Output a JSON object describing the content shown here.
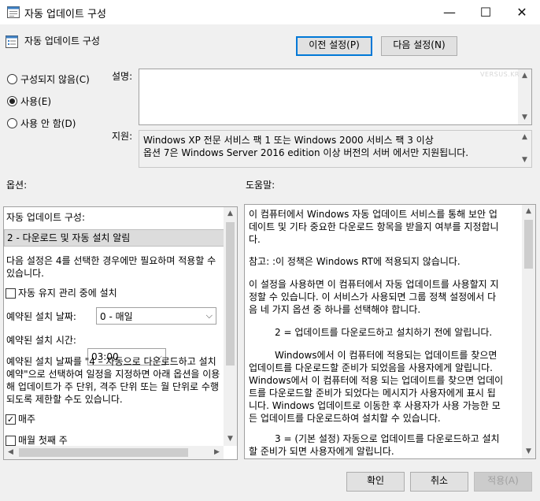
{
  "window": {
    "title": "자동 업데이트 구성",
    "minimize": "—",
    "maximize": "☐",
    "close": "✕"
  },
  "header": {
    "policy_title": "자동 업데이트 구성",
    "prev_button": "이전 설정(P)",
    "next_button": "다음 설정(N)"
  },
  "state": {
    "not_configured": "구성되지 않음(C)",
    "enabled": "사용(E)",
    "disabled": "사용 안 함(D)",
    "selected": "enabled"
  },
  "comment": {
    "label": "설명:",
    "value": "",
    "watermark": "VERSUS.KR"
  },
  "supported": {
    "label": "지원:",
    "line1": "Windows XP 전문 서비스 팩 1 또는 Windows 2000 서비스 팩 3 이상",
    "line2": "옵션 7은 Windows Server 2016 edition 이상 버전의 서버 에서만 지원됩니다."
  },
  "options": {
    "label": "옵션:",
    "configure_label": "자동 업데이트 구성:",
    "configure_value": "2 - 다운로드 및 자동 설치 알림",
    "note_line1": "다음 설정은 4를 선택한 경우에만 필요하며 적용할 수",
    "note_line2": "있습니다.",
    "maintenance_label": "자동 유지 관리 중에 설치",
    "maintenance_checked": false,
    "day_label": "예약된 설치 날짜:",
    "day_value": "0 - 매일",
    "time_label": "예약된 설치 시간:",
    "time_value": "03:00",
    "info_line1": "예약된 설치 날짜를 \"4 – 자동으로 다운로드하고 설치",
    "info_line2": "예약\"으로 선택하여 일정을 지정하면 아래 옵션을 이용",
    "info_line3": "해 업데이트가 주 단위, 격주 단위 또는 월 단위로 수행",
    "info_line4": "되도록 제한할 수도 있습니다.",
    "every_week_label": "매주",
    "every_week_checked": true,
    "first_week_label": "매월 첫째 주",
    "first_week_checked": false
  },
  "help": {
    "label": "도움말:",
    "p1_l1": "이 컴퓨터에서 Windows 자동 업데이트 서비스를 통해 보안 업",
    "p1_l2": "데이트 및 기타 중요한 다운로드 항목을 받을지 여부를 지정합니",
    "p1_l3": "다.",
    "p2": "참고: :이 정책은 Windows RT에 적용되지 않습니다.",
    "p3_l1": "이 설정을 사용하면 이 컴퓨터에서 자동 업데이트를 사용할지 지",
    "p3_l2": "정할 수 있습니다. 이 서비스가 사용되면 그룹 정책 설정에서 다",
    "p3_l3": "음 네 가지 옵션 중 하나를 선택해야 합니다.",
    "p4": "2 = 업데이트를 다운로드하고 설치하기 전에 알립니다.",
    "p5_l1": "Windows에서 이 컴퓨터에 적용되는 업데이트를 찾으면",
    "p5_l2": "업데이트를 다운로드할 준비가 되었음을 사용자에게 알립니다.",
    "p5_l3": "Windows에서 이 컴퓨터에 적용 되는 업데이트를 찾으면 업데이",
    "p5_l4": "트를 다운로드할 준비가 되었다는 메시지가 사용자에게 표시 됩",
    "p5_l5": "니다. Windows 업데이트로 이동한 후 사용자가 사용 가능한 모",
    "p5_l6": "든 업데이트를 다운로드하여 설치할 수 있습니다.",
    "p6_l1": "3 = (기본 설정) 자동으로 업데이트를 다운로드하고 설치",
    "p6_l2": "할 준비가 되면 사용자에게 알립니다."
  },
  "footer": {
    "ok": "확인",
    "cancel": "취소",
    "apply": "적용(A)"
  }
}
